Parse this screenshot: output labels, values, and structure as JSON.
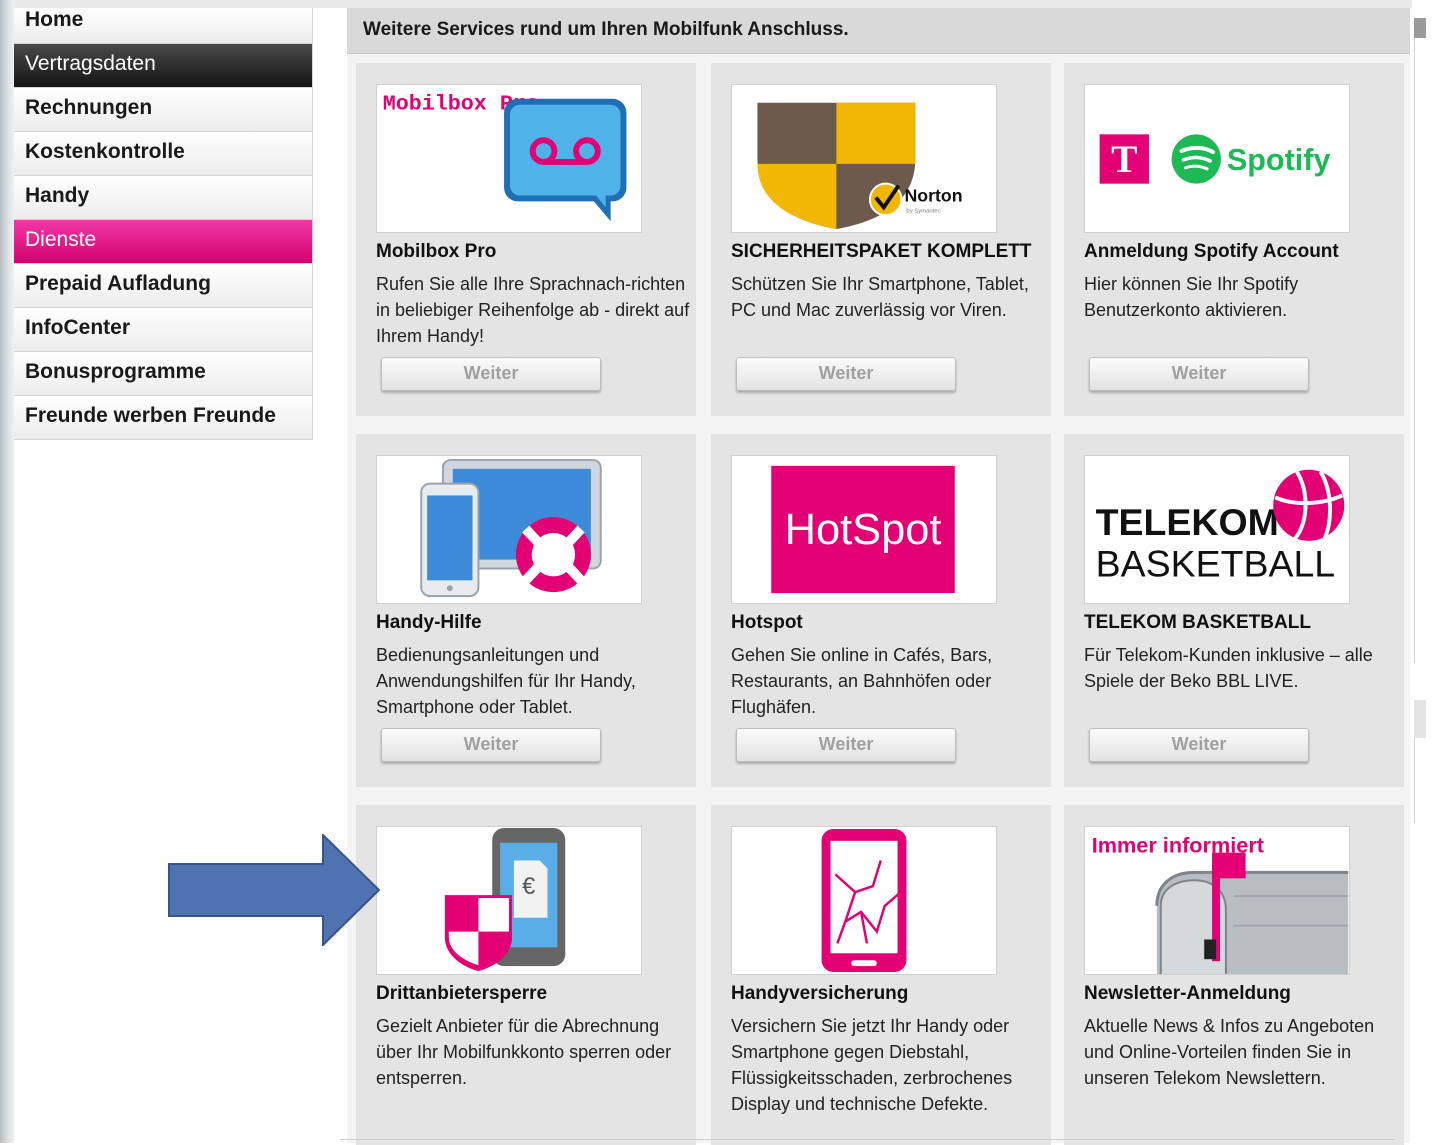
{
  "sidebar": {
    "items": [
      {
        "label": "Home"
      },
      {
        "label": "Vertragsdaten"
      },
      {
        "label": "Rechnungen"
      },
      {
        "label": "Kostenkontrolle"
      },
      {
        "label": "Handy"
      },
      {
        "label": "Dienste"
      },
      {
        "label": "Prepaid Aufladung"
      },
      {
        "label": "InfoCenter"
      },
      {
        "label": "Bonusprogramme"
      },
      {
        "label": "Freunde werben Freunde"
      }
    ]
  },
  "content": {
    "title": "Weitere Services rund um Ihren Mobilfunk Anschluss.",
    "button_label": "Weiter",
    "cards": [
      {
        "title": "Mobilbox Pro",
        "description": "Rufen Sie alle Ihre Sprachnach-richten in beliebiger Reihenfolge ab - direkt auf Ihrem Handy!",
        "image_text": "Mobilbox Pro",
        "icon": "voicemail-bubble-icon"
      },
      {
        "title": "SICHERHEITSPAKET KOMPLETT",
        "description": "Schützen Sie Ihr Smartphone, Tablet, PC und Mac zuverlässig vor Viren.",
        "image_text": "Norton",
        "image_subtext": "by Symantec",
        "icon": "norton-shield-icon"
      },
      {
        "title": "Anmeldung Spotify Account",
        "description": "Hier können Sie Ihr Spotify Benutzerkonto aktivieren.",
        "image_text": "Spotify",
        "icon": "telekom-spotify-logo"
      },
      {
        "title": "Handy-Hilfe",
        "description": "Bedienungsanleitungen und Anwendungshilfen für Ihr Handy, Smartphone oder Tablet.",
        "icon": "devices-lifebuoy-icon"
      },
      {
        "title": "Hotspot",
        "description": "Gehen Sie online in Cafés, Bars, Restaurants, an Bahnhöfen oder Flughäfen.",
        "image_text": "HotSpot",
        "icon": "hotspot-logo"
      },
      {
        "title": "TELEKOM BASKETBALL",
        "description": "Für Telekom-Kunden inklusive – alle Spiele der Beko BBL LIVE.",
        "image_text_1": "TELEKOM",
        "image_text_2": "BASKETBALL",
        "icon": "basketball-icon"
      },
      {
        "title": "Drittanbietersperre",
        "description": "Gezielt Anbieter für die Abrechnung über Ihr Mobilfunkkonto sperren oder entsperren.",
        "image_text": "€",
        "icon": "phone-shield-euro-icon"
      },
      {
        "title": "Handyversicherung",
        "description": "Versichern Sie jetzt Ihr Handy oder Smartphone gegen Diebstahl, Flüssigkeitsschaden, zerbrochenes Display und technische Defekte.",
        "icon": "cracked-phone-icon"
      },
      {
        "title": "Newsletter-Anmeldung",
        "description": "Aktuelle News & Infos zu Angeboten und Online-Vorteilen finden Sie in unseren Telekom Newslettern.",
        "image_text": "Immer informiert",
        "icon": "mailbox-icon"
      }
    ]
  },
  "colors": {
    "magenta": "#e20074",
    "arrow": "#4f72b0",
    "dark_nav": "#222222"
  }
}
